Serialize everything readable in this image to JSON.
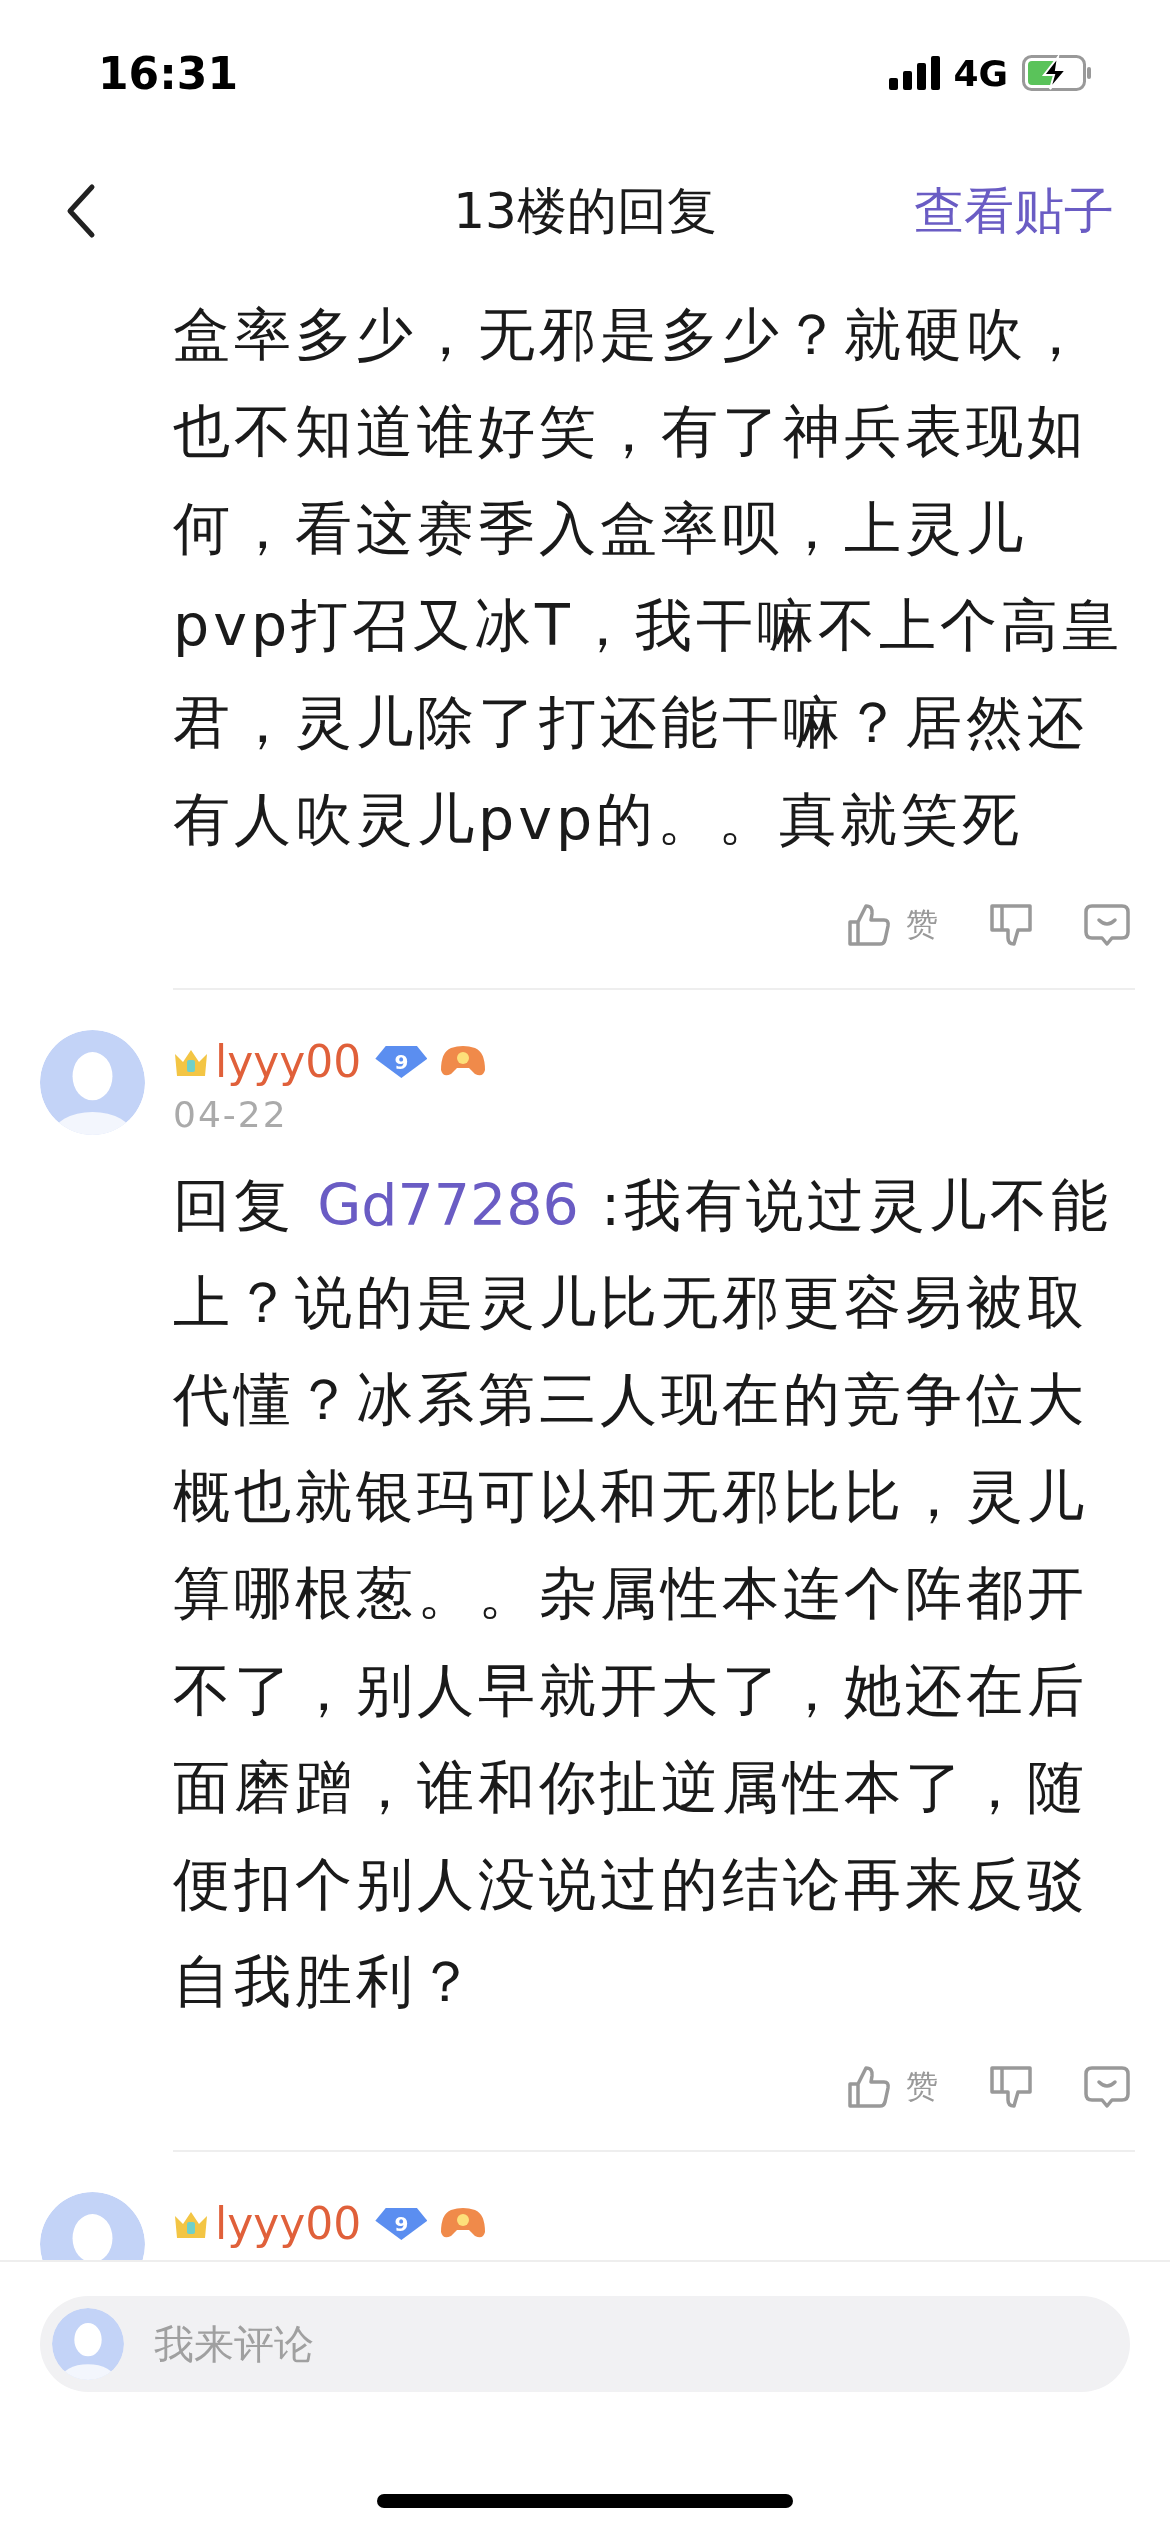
{
  "status_bar": {
    "time": "16:31",
    "network": "4G",
    "charging": true
  },
  "nav": {
    "title": "13楼的回复",
    "action": "查看贴子"
  },
  "comments": [
    {
      "kind": "body_only",
      "body": "盒率多少，无邪是多少？就硬吹，也不知道谁好笑，有了神兵表现如何，看这赛季入盒率呗，上灵儿pvp打召又冰T，我干嘛不上个高皇君，灵儿除了打还能干嘛？居然还有人吹灵儿pvp的。。真就笑死",
      "like_label": "赞"
    },
    {
      "kind": "full",
      "author": "lyyy00",
      "level": "9",
      "date": "04-22",
      "reply_prefix": "回复 ",
      "mention": "Gd77286",
      "body": " :我有说过灵儿不能上？说的是灵儿比无邪更容易被取代懂？冰系第三人现在的竞争位大概也就银玛可以和无邪比比，灵儿算哪根葱。。杂属性本连个阵都开不了，别人早就开大了，她还在后面磨蹭，谁和你扯逆属性本了，随便扣个别人没说过的结论再来反驳自我胜利？",
      "like_label": "赞"
    },
    {
      "kind": "header_only",
      "author": "lyyy00",
      "level": "9"
    }
  ],
  "comment_bar": {
    "placeholder": "我来评论"
  }
}
